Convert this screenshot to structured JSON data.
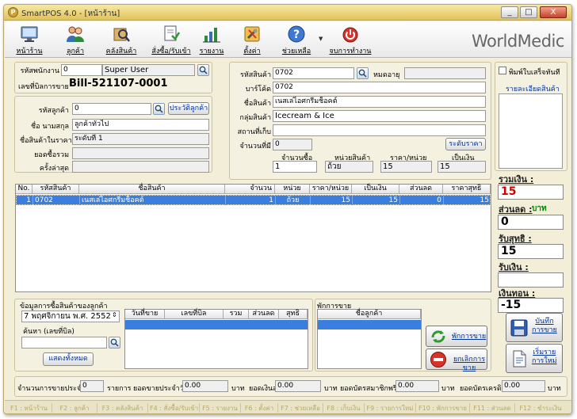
{
  "window": {
    "title": "SmartPOS 4.0 - [หน้าร้าน]",
    "app_icon": "P",
    "controls": [
      "_",
      "□",
      "X"
    ]
  },
  "toolbar": {
    "items": [
      {
        "label": "หน้าร้าน",
        "icon": "monitor-icon"
      },
      {
        "label": "ลูกค้า",
        "icon": "customers-icon"
      },
      {
        "label": "คลังสินค้า",
        "icon": "warehouse-icon"
      },
      {
        "label": "สั่งซื้อ/รับเข้า",
        "icon": "order-receive-icon"
      },
      {
        "label": "รายงาน",
        "icon": "report-chart-icon"
      },
      {
        "label": "ตั้งค่า",
        "icon": "settings-tools-icon"
      },
      {
        "label": "ช่วยเหลือ",
        "icon": "help-icon"
      },
      {
        "label": "จบการทำงาน",
        "icon": "exit-power-icon"
      }
    ],
    "logo": "WorldMedic"
  },
  "employee": {
    "label": "รหัสพนักงาน",
    "code": "0",
    "name": "Super User"
  },
  "bill": {
    "label": "เลขที่บิลการขาย",
    "value": "Bill-521107-0001"
  },
  "customer": {
    "code_label": "รหัสลูกค้า",
    "code": "0",
    "history_button": "ประวัติลูกค้า",
    "name_label": "ชื่อ นามสกุล",
    "name": "ลูกค้าทั่วไป",
    "price_level_label": "ชื่อสินค้าในราคา",
    "price_level": "ระดับที่ 1",
    "total_label": "ยอดซื้อรวม",
    "total": "",
    "last_label": "ครั้งล่าสุด",
    "last": ""
  },
  "product": {
    "code_label": "รหัสสินค้า",
    "code": "0702",
    "category_label": "หมดอายุ",
    "category": "",
    "barcode_label": "บาร์โค้ด",
    "barcode": "0702",
    "name_label": "ชื่อสินค้า",
    "name": "เนสเล่ไอศกรีมช็อคต์",
    "group_label": "กลุ่มสินค้า",
    "group": "Icecream & Ice",
    "location_label": "สถานที่เก็บ",
    "location": "",
    "stock_label": "จำนวนที่มี",
    "stock": "0",
    "price_level_button": "ระดับราคา",
    "qty_label": "จำนวนซื้อ",
    "qty": "1",
    "unit_label": "หน่วยสินค้า",
    "unit": "ถ้วย",
    "unit_price_label": "ราคา/หน่วย",
    "unit_price": "15",
    "amount_label": "เป็นเงิน",
    "amount": "15"
  },
  "print": {
    "checkbox_label": "พิมพ์ใบเสร็จทันที",
    "checked": false,
    "detail_label": "รายละเอียดสินค้า"
  },
  "items_table": {
    "headers": [
      "No.",
      "รหัสสินค้า",
      "ชื่อสินค้า",
      "จำนวน",
      "หน่วย",
      "ราคา/หน่วย",
      "เป็นเงิน",
      "ส่วนลด",
      "ราคาสุทธิ"
    ],
    "rows": [
      [
        "1",
        "0702",
        "เนสเล่ไอศกรีมช็อคต์",
        "1",
        "ถ้วย",
        "15",
        "15",
        "0",
        "15"
      ]
    ]
  },
  "totals": {
    "total_label": "รวมเงิน :",
    "total": "15",
    "discount_label": "ส่วนลด :",
    "discount_unit": "บาท",
    "discount": "0",
    "net_label": "รับสุทธิ :",
    "net": "15",
    "received_label": "รับเงิน :",
    "received": "",
    "change_label": "เงินทอน :",
    "change": "-15"
  },
  "history": {
    "title": "ข้อมูลการซื้อสินค้าของลูกค้า",
    "date": "7 พฤศจิกายน พ.ศ. 2552",
    "search_label": "ค้นหา (เลขที่บิล)",
    "search_value": "",
    "show_all_button": "แสดงทั้งหมด",
    "headers": [
      "วันที่ขาย",
      "เลขที่บิล",
      "รวม",
      "ส่วนลด",
      "สุทธิ"
    ]
  },
  "suspended": {
    "title": "พักการขาย",
    "headers": [
      "ชื่อลูกค้า"
    ]
  },
  "actions": {
    "suspend": "พักการขาย",
    "cancel": "ยกเลิกการขาย",
    "save_line1": "บันทึก",
    "save_line2": "การขาย",
    "new_line1": "เริ่มราย",
    "new_line2": "การใหม่"
  },
  "summary": {
    "daily_count_label": "จำนวนการขายประจำวัน",
    "daily_count": "0",
    "count_unit": "รายการ",
    "daily_sales_label": "ยอดขายประจำวัน",
    "daily_sales": "0.00",
    "baht1": "บาท",
    "cash_label": "ยอดเงินสด",
    "cash": "0.00",
    "baht2": "บาท",
    "credit_label": "ยอดบัตรสมาชิกพรีเมี่ยม",
    "credit": "0.00",
    "baht3": "บาท",
    "card_label": "ยอดบัตรเครดิต",
    "card": "0.00",
    "baht4": "บาท"
  },
  "shortcuts": [
    "F1 : หน้าร้าน",
    "F2 : ลูกค้า",
    "F3 : คลังสินค้า",
    "F4 : สั่งซื้อ/รับเข้า",
    "F5 : รายงาน",
    "F6 : ตั้งค่า",
    "F7 : ช่วยเหลือ",
    "F8 : เก็บเงิน",
    "F9 : รายการใหม่",
    "F10 : พักการขาย",
    "F11 : ส่วนลด",
    "F12 : ชำระเงิน"
  ],
  "colors": {
    "accent_select": "#3a7fe0",
    "frame": "#f2eed8",
    "total_red": "#cc0000",
    "discount_green": "#008000"
  }
}
